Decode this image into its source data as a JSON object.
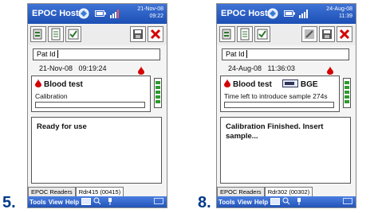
{
  "steps": [
    "5.",
    "8."
  ],
  "screens": [
    {
      "app_title": "EPOC Host",
      "date": "21-Nov-08",
      "time": "09:22",
      "pat_id_label": "Pat Id",
      "pat_id_value": "",
      "datetime": "21-Nov-08   09:19:24",
      "test_title": "Blood test",
      "test_extra": "",
      "status_line": "Calibration",
      "progress": 0.0,
      "message": "Ready for use",
      "tabs": [
        "EPOC Readers",
        "Rdr415 (00415)"
      ],
      "menu": [
        "Tools",
        "View",
        "Help"
      ]
    },
    {
      "app_title": "EPOC Host",
      "date": "24-Aug-08",
      "time": "11:39",
      "pat_id_label": "Pat Id",
      "pat_id_value": "",
      "datetime": "24-Aug-08   11:36:03",
      "test_title": "Blood test",
      "test_extra": "BGE",
      "status_line": "Time left to introduce sample 274s",
      "progress": 0.0,
      "message": "Calibration Finished. Insert sample...",
      "tabs": [
        "EPOC Readers",
        "Rdr302 (00302)"
      ],
      "menu": [
        "Tools",
        "View",
        "Help"
      ]
    }
  ],
  "colors": {
    "titlebar": "#2a5fc8",
    "drop": "#d40000",
    "battery": "#2d9a2d",
    "step_number": "#003a8c"
  }
}
